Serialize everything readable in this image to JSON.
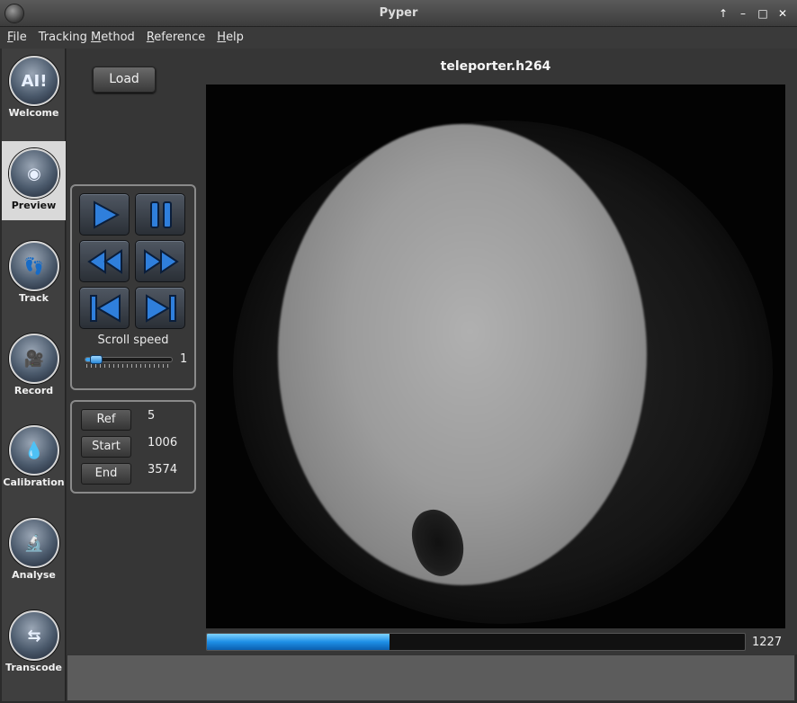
{
  "window": {
    "title": "Pyper",
    "buttons": [
      "↑",
      "–",
      "□",
      "✕"
    ]
  },
  "menu": [
    {
      "label": "File"
    },
    {
      "label": "Tracking Method"
    },
    {
      "label": "Reference"
    },
    {
      "label": "Help"
    }
  ],
  "nav": {
    "items": [
      {
        "label": "Welcome",
        "icon": "welcome-icon",
        "glyph": "AI!"
      },
      {
        "label": "Preview",
        "icon": "eye-icon",
        "glyph": "◉"
      },
      {
        "label": "Track",
        "icon": "footprints-icon",
        "glyph": "👣"
      },
      {
        "label": "Record",
        "icon": "camera-icon",
        "glyph": "🎥"
      },
      {
        "label": "Calibration",
        "icon": "drop-icon",
        "glyph": "💧"
      },
      {
        "label": "Analyse",
        "icon": "analyse-icon",
        "glyph": "🔬"
      },
      {
        "label": "Transcode",
        "icon": "transcode-icon",
        "glyph": "⇆"
      }
    ],
    "active": "Preview"
  },
  "main": {
    "load_label": "Load",
    "video_title": "teleporter.h264",
    "progress_fraction": 0.34,
    "current_frame": "1227"
  },
  "playback": {
    "scroll_speed_label": "Scroll speed",
    "scroll_speed_value": "1",
    "scroll_speed_fraction": 0.12
  },
  "frames": {
    "ref_label": "Ref",
    "ref_value": "5",
    "start_label": "Start",
    "start_value": "1006",
    "end_label": "End",
    "end_value": "3574"
  },
  "colors": {
    "accent": "#1e8fe6",
    "active_nav": "#d9d9d9"
  }
}
